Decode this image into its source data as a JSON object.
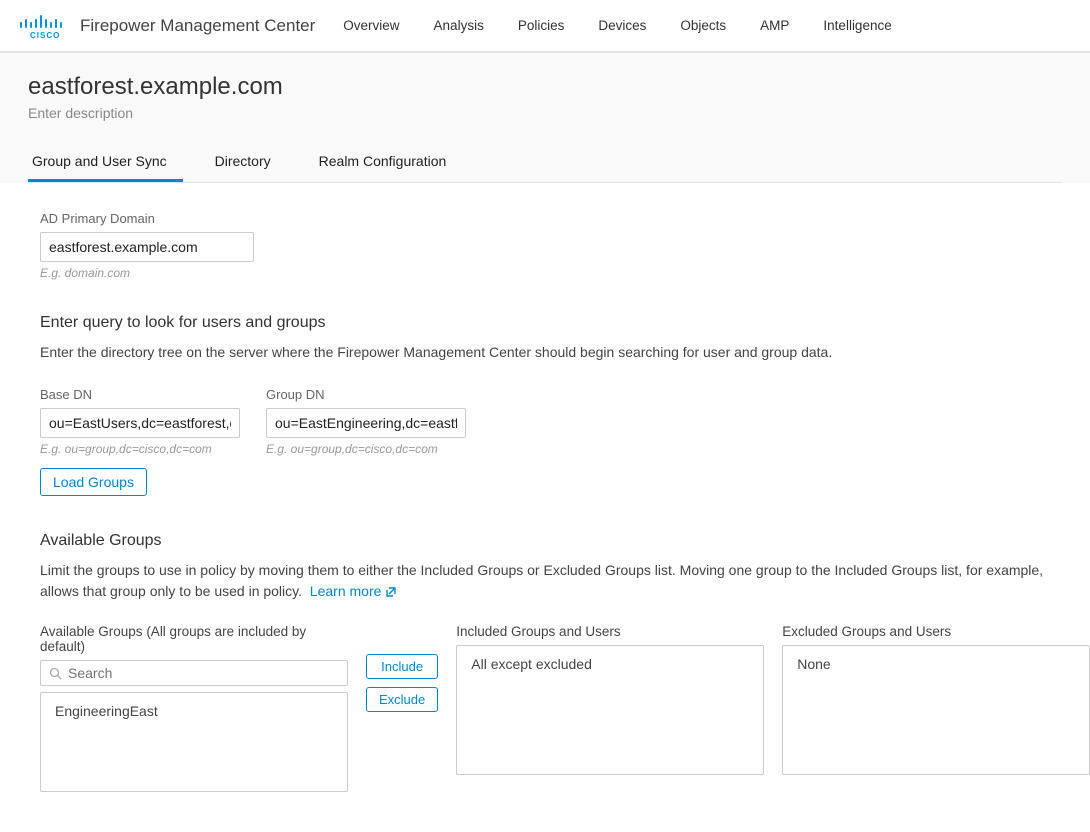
{
  "header": {
    "product": "Firepower Management Center",
    "nav": [
      "Overview",
      "Analysis",
      "Policies",
      "Devices",
      "Objects",
      "AMP",
      "Intelligence"
    ]
  },
  "page": {
    "title": "eastforest.example.com",
    "subtitle": "Enter description"
  },
  "tabs": [
    "Group and User Sync",
    "Directory",
    "Realm Configuration"
  ],
  "ad": {
    "label": "AD Primary Domain",
    "value": "eastforest.example.com",
    "hint": "E.g. domain.com"
  },
  "query": {
    "title": "Enter query to look for users and groups",
    "desc": "Enter the directory tree on the server where the Firepower Management Center should begin searching for user and group data.",
    "base": {
      "label": "Base DN",
      "value": "ou=EastUsers,dc=eastforest,dc=",
      "hint": "E.g. ou=group,dc=cisco,dc=com"
    },
    "group": {
      "label": "Group DN",
      "value": "ou=EastEngineering,dc=eastfore",
      "hint": "E.g. ou=group,dc=cisco,dc=com"
    },
    "load_btn": "Load Groups"
  },
  "groups": {
    "title": "Available Groups",
    "desc": "Limit the groups to use in policy by moving them to either the Included Groups or Excluded Groups list. Moving one group to the Included Groups list, for example, allows that group only to be used in policy.",
    "learn_more": "Learn more",
    "available_label": "Available Groups (All groups are included by default)",
    "search_placeholder": "Search",
    "available_items": [
      "EngineeringEast"
    ],
    "include_btn": "Include",
    "exclude_btn": "Exclude",
    "included_label": "Included Groups and Users",
    "included_text": "All except excluded",
    "excluded_label": "Excluded Groups and Users",
    "excluded_text": "None"
  }
}
